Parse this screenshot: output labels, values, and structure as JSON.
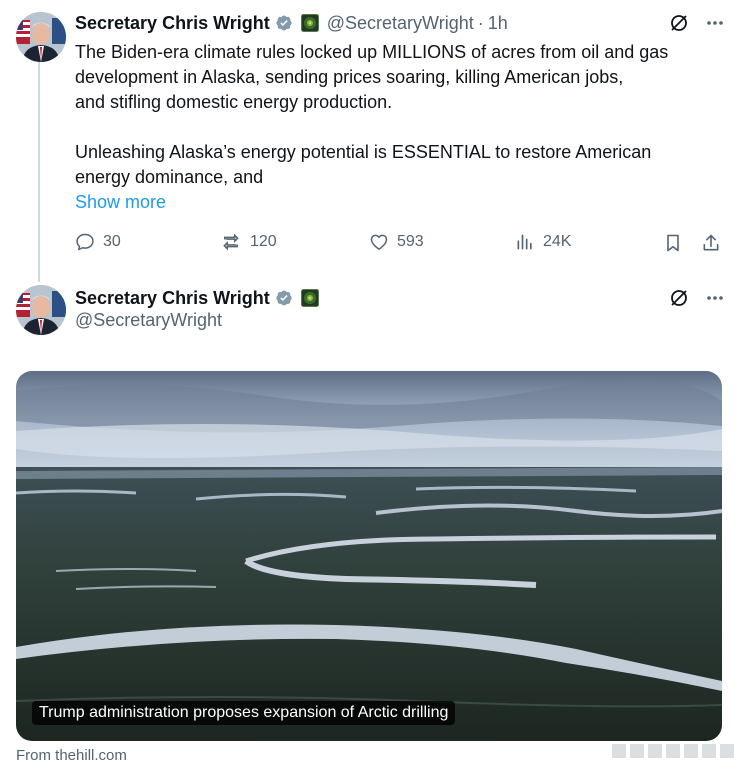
{
  "tweet1": {
    "author_name": "Secretary Chris Wright",
    "handle": "@SecretaryWright",
    "separator": "·",
    "time": "1h",
    "text_lines": [
      "The Biden-era climate rules locked up MILLIONS of acres from oil and gas",
      "development in Alaska, sending prices soaring, killing American jobs,",
      "and stifling domestic energy production.",
      "",
      "Unleashing Alaska’s energy potential is ESSENTIAL to restore American",
      "energy dominance, and"
    ],
    "show_more": "Show more",
    "actions": {
      "replies": "30",
      "reposts": "120",
      "likes": "593",
      "views": "24K"
    }
  },
  "tweet2": {
    "author_name": "Secretary Chris Wright",
    "handle": "@SecretaryWright",
    "card": {
      "caption": "Trump administration proposes expansion of Arctic drilling",
      "source": "From thehill.com"
    }
  },
  "colors": {
    "text_primary": "#0f1419",
    "text_secondary": "#536471",
    "link": "#1d9bf0",
    "verified_badge": "#829aab",
    "thread_line": "#cfd9de"
  },
  "icons": {
    "verified": "verified-badge-icon",
    "agency": "energy-department-seal-icon",
    "grok": "grok-icon",
    "more": "more-icon",
    "reply": "reply-icon",
    "repost": "repost-icon",
    "like": "heart-icon",
    "views": "views-icon",
    "bookmark": "bookmark-icon",
    "share": "share-icon"
  }
}
